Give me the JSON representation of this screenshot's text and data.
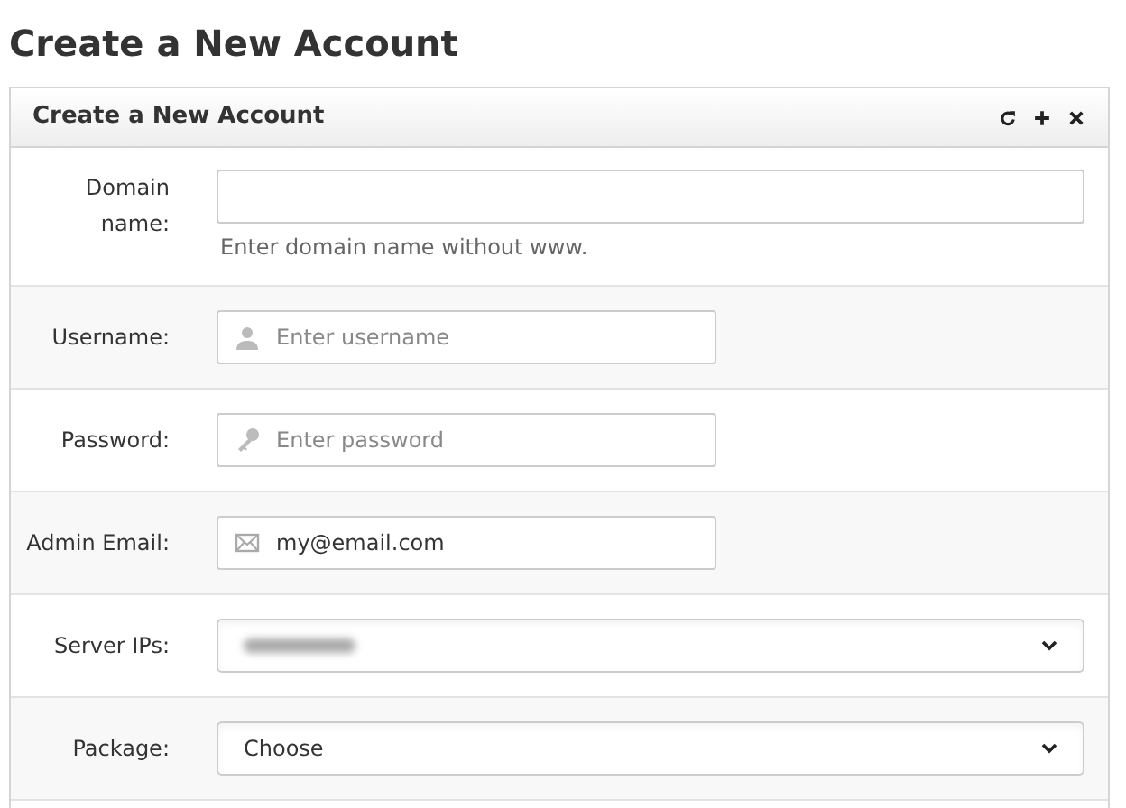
{
  "page_title": "Create a New Account",
  "panel": {
    "title": "Create a New Account",
    "toolbar": [
      {
        "kind": "reload"
      },
      {
        "kind": "add"
      },
      {
        "kind": "close"
      }
    ]
  },
  "fields": [
    {
      "kind": "plain",
      "label": "Domain name:",
      "hint": "Enter domain name without www."
    },
    {
      "kind": "user",
      "label": "Username:",
      "placeholder": "Enter username"
    },
    {
      "kind": "password",
      "label": "Password:",
      "placeholder": "Enter password"
    },
    {
      "kind": "email",
      "label": "Admin Email:",
      "value": "my@email.com"
    },
    {
      "kind": "select",
      "label": "Server IPs:",
      "redacted": true
    },
    {
      "kind": "select",
      "label": "Package:",
      "value": "Choose"
    }
  ]
}
